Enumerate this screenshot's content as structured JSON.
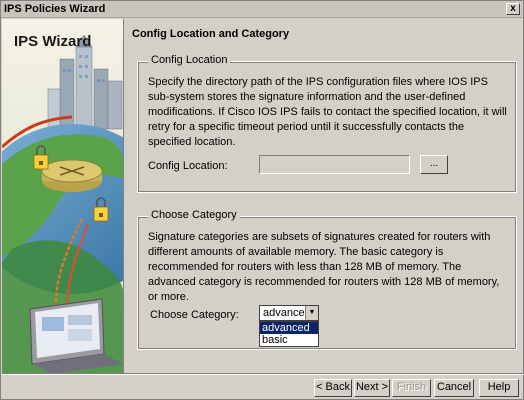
{
  "window": {
    "title": "IPS Policies Wizard",
    "close_label": "x"
  },
  "wizard": {
    "title": "IPS Wizard"
  },
  "page": {
    "title": "Config Location and Category"
  },
  "config_location": {
    "legend": "Config Location",
    "description": "Specify the directory path of the IPS configuration files where IOS IPS sub-system stores the signature information and the user-defined modifications. If Cisco IOS IPS fails to contact the specified location, it will retry for a specific timeout period until it successfully contacts the specified location.",
    "label": "Config Location:",
    "value": "",
    "browse_label": "..."
  },
  "choose_category": {
    "legend": "Choose Category",
    "description": "Signature categories are subsets of signatures created for routers with different amounts of available memory. The basic category is recommended for routers with less than 128 MB of memory. The advanced category is recommended for routers with 128 MB of memory, or more.",
    "label": "Choose Category:",
    "selected": "advanced",
    "options": [
      "advanced",
      "basic"
    ]
  },
  "buttons": {
    "back": "< Back",
    "next": "Next >",
    "finish": "Finish",
    "cancel": "Cancel",
    "help": "Help"
  },
  "colors": {
    "selection": "#0a246a",
    "window_bg": "#d4d0c8"
  },
  "icons": [
    "close-icon",
    "dropdown-arrow-icon",
    "lock-icon",
    "router-icon",
    "building-icon",
    "laptop-icon"
  ]
}
